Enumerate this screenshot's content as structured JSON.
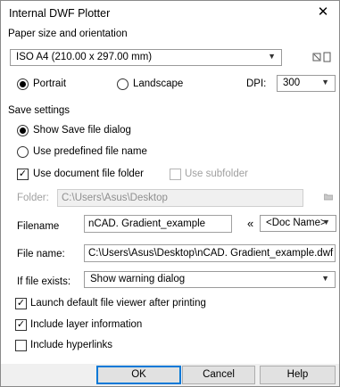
{
  "window": {
    "title": "Internal DWF Plotter",
    "close_glyph": "✕"
  },
  "paper": {
    "heading": "Paper size and orientation",
    "size_value": "ISO A4 (210.00 x 297.00 mm)",
    "portrait_label": "Portrait",
    "landscape_label": "Landscape",
    "orientation": "Portrait",
    "dpi_label": "DPI:",
    "dpi_value": "300"
  },
  "save": {
    "heading": "Save settings",
    "show_dialog_label": "Show Save file dialog",
    "predefined_label": "Use predefined file name",
    "selected_mode": "Show Save file dialog",
    "use_doc_folder_label": "Use document file folder",
    "use_doc_folder_checked": true,
    "use_subfolder_label": "Use subfolder",
    "use_subfolder_checked": false,
    "folder_label": "Folder:",
    "folder_value": "C:\\Users\\Asus\\Desktop",
    "filename_label": "Filename",
    "filename_value": "nCAD. Gradient_example",
    "insert_glyph": "«",
    "doc_name_value": "<Doc Name>",
    "file_name_label": "File name:",
    "file_name_value": "C:\\Users\\Asus\\Desktop\\nCAD. Gradient_example.dwf",
    "if_exists_label": "If file exists:",
    "if_exists_value": "Show warning dialog"
  },
  "options": {
    "launch_viewer_label": "Launch default file viewer after printing",
    "launch_viewer_checked": true,
    "layer_info_label": "Include layer information",
    "layer_info_checked": true,
    "hyperlinks_label": "Include hyperlinks",
    "hyperlinks_checked": false
  },
  "buttons": {
    "ok": "OK",
    "cancel": "Cancel",
    "help": "Help"
  },
  "icons": {
    "dropdown": "chevron-down-icon",
    "folder": "folder-icon",
    "orientation_preview": "page-preview-icon",
    "check": "✓"
  }
}
